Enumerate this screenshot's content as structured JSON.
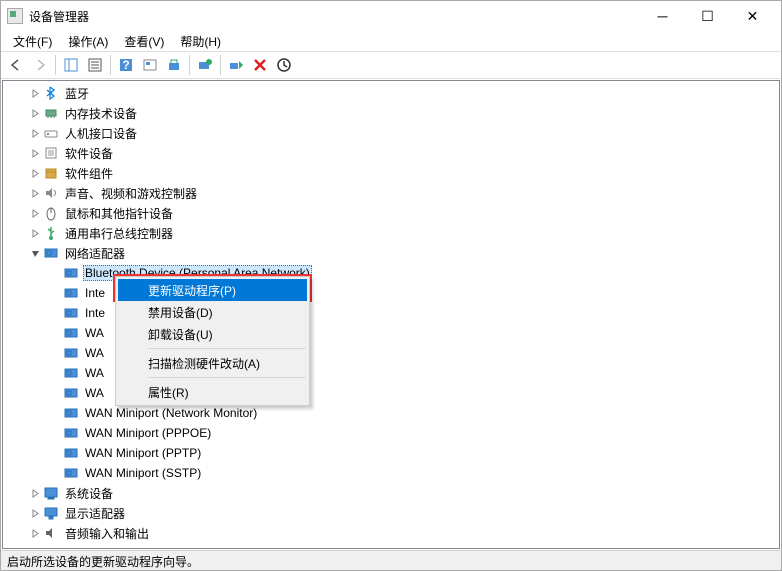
{
  "window": {
    "title": "设备管理器"
  },
  "menu": {
    "file": "文件(F)",
    "action": "操作(A)",
    "view": "查看(V)",
    "help": "帮助(H)"
  },
  "categories": [
    {
      "id": "bluetooth",
      "label": "蓝牙",
      "icon": "bt",
      "expanded": false
    },
    {
      "id": "memory",
      "label": "内存技术设备",
      "icon": "mem",
      "expanded": false
    },
    {
      "id": "hid",
      "label": "人机接口设备",
      "icon": "hid",
      "expanded": false
    },
    {
      "id": "software-devices",
      "label": "软件设备",
      "icon": "soft",
      "expanded": false
    },
    {
      "id": "software-components",
      "label": "软件组件",
      "icon": "pkg",
      "expanded": false
    },
    {
      "id": "audio-video-game",
      "label": "声音、视频和游戏控制器",
      "icon": "audio",
      "expanded": false
    },
    {
      "id": "mouse",
      "label": "鼠标和其他指针设备",
      "icon": "mouse",
      "expanded": false
    },
    {
      "id": "usb",
      "label": "通用串行总线控制器",
      "icon": "usb",
      "expanded": false
    },
    {
      "id": "network",
      "label": "网络适配器",
      "icon": "net",
      "expanded": true
    },
    {
      "id": "system",
      "label": "系统设备",
      "icon": "sys",
      "expanded": false
    },
    {
      "id": "display",
      "label": "显示适配器",
      "icon": "disp",
      "expanded": false
    },
    {
      "id": "audio-io",
      "label": "音频输入和输出",
      "icon": "aio",
      "expanded": false
    }
  ],
  "network_children": [
    {
      "label": "Bluetooth Device (Personal Area Network)",
      "selected": true
    },
    {
      "label": "Inte"
    },
    {
      "label": "Inte"
    },
    {
      "label": "WA"
    },
    {
      "label": "WA"
    },
    {
      "label": "WA"
    },
    {
      "label": "WA"
    },
    {
      "label": "WAN Miniport (Network Monitor)"
    },
    {
      "label": "WAN Miniport (PPPOE)"
    },
    {
      "label": "WAN Miniport (PPTP)"
    },
    {
      "label": "WAN Miniport (SSTP)"
    }
  ],
  "context_menu": {
    "update_driver": "更新驱动程序(P)",
    "disable": "禁用设备(D)",
    "uninstall": "卸载设备(U)",
    "scan": "扫描检测硬件改动(A)",
    "properties": "属性(R)"
  },
  "status": "启动所选设备的更新驱动程序向导。"
}
